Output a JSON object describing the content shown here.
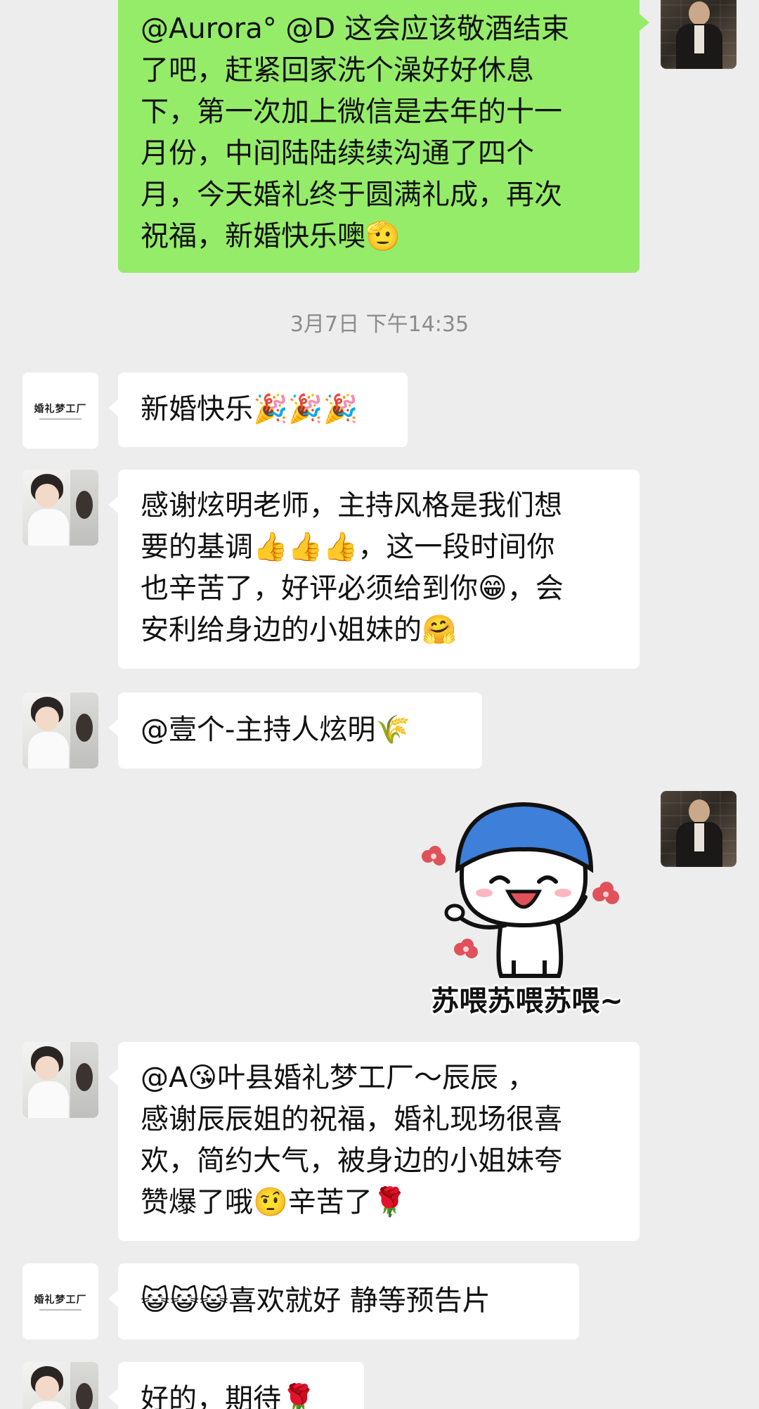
{
  "timestamp": "3月7日 下午14:35",
  "messages": {
    "m1": {
      "lines": [
        "@Aurora° @D  这会应该敬酒结束",
        "了吧，赶紧回家洗个澡好好休息",
        "下，第一次加上微信是去年的十一",
        "月份，中间陆陆续续沟通了四个",
        "月，今天婚礼终于圆满礼成，再次",
        "祝福，新婚快乐噢🫡"
      ]
    },
    "m2": {
      "text": "新婚快乐🎉🎉🎉"
    },
    "m3": {
      "lines": [
        "感谢炫明老师，主持风格是我们想",
        "要的基调👍👍👍，这一段时间你",
        "也辛苦了，好评必须给到你😁，会",
        "安利给身边的小姐妹的🤗"
      ]
    },
    "m4": {
      "text": "@壹个-主持人炫明🌾"
    },
    "m5": {
      "caption": "苏喂苏喂苏喂~"
    },
    "m6": {
      "lines": [
        "@A😘叶县婚礼梦工厂～辰辰 ，",
        "感谢辰辰姐的祝福，婚礼现场很喜",
        "欢，简约大气，被身边的小姐妹夸",
        "赞爆了哦🤨辛苦了🌹"
      ]
    },
    "m7": {
      "text": "😺😺😺喜欢就好 静等预告片"
    },
    "m8": {
      "text": "好的，期待🌹"
    }
  },
  "avatars": {
    "brand_text": "婚礼梦工厂"
  },
  "colors": {
    "background": "#EDEDED",
    "outgoing_bubble": "#95EC69",
    "incoming_bubble": "#FFFFFF",
    "timestamp_text": "#8C8C8C"
  }
}
